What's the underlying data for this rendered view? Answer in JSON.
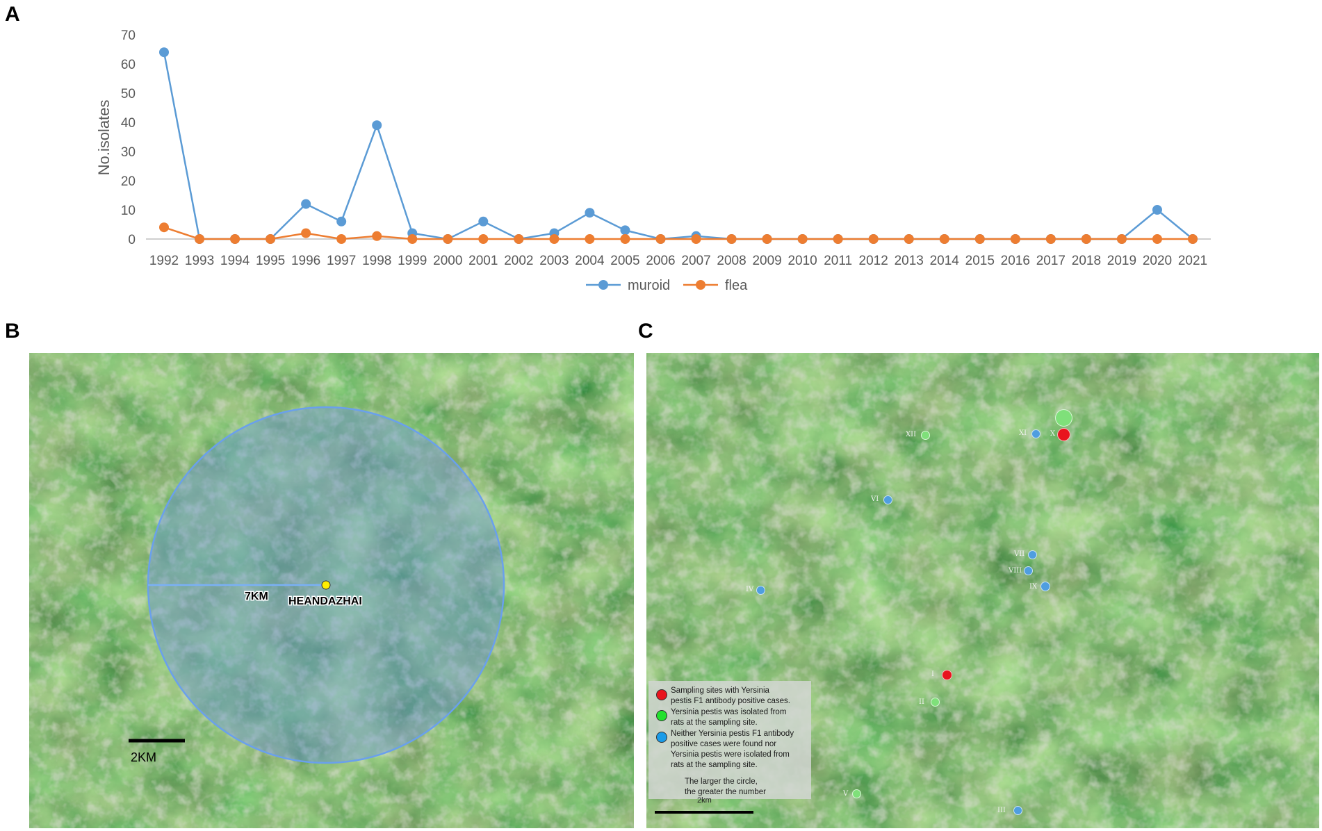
{
  "panels": {
    "a": "A",
    "b": "B",
    "c": "C"
  },
  "chart_data": {
    "type": "line",
    "ylabel": "No.isolates",
    "xlabel": "",
    "ylim": [
      0,
      70
    ],
    "yticks": [
      0,
      10,
      20,
      30,
      40,
      50,
      60,
      70
    ],
    "grid": false,
    "legend_position": "bottom",
    "categories": [
      "1992",
      "1993",
      "1994",
      "1995",
      "1996",
      "1997",
      "1998",
      "1999",
      "2000",
      "2001",
      "2002",
      "2003",
      "2004",
      "2005",
      "2006",
      "2007",
      "2008",
      "2009",
      "2010",
      "2011",
      "2012",
      "2013",
      "2014",
      "2015",
      "2016",
      "2017",
      "2018",
      "2019",
      "2020",
      "2021"
    ],
    "series": [
      {
        "name": "muroid",
        "color": "#5b9bd5",
        "values": [
          64,
          0,
          0,
          0,
          12,
          6,
          39,
          2,
          0,
          6,
          0,
          2,
          9,
          3,
          0,
          1,
          0,
          0,
          0,
          0,
          0,
          0,
          0,
          0,
          0,
          0,
          0,
          0,
          10,
          0
        ]
      },
      {
        "name": "flea",
        "color": "#ed7d31",
        "values": [
          4,
          0,
          0,
          0,
          2,
          0,
          1,
          0,
          0,
          0,
          0,
          0,
          0,
          0,
          0,
          0,
          0,
          0,
          0,
          0,
          0,
          0,
          0,
          0,
          0,
          0,
          0,
          0,
          0,
          0
        ]
      }
    ]
  },
  "map_b": {
    "radius_label": "7KM",
    "place_label": "HEANDAZHAI",
    "scale_label": "2KM",
    "circle_color": "#5b8fd6",
    "marker_color": "#ffee00"
  },
  "map_c": {
    "scale_label": "2km",
    "legend": {
      "items": [
        {
          "color": "#e8141e",
          "text": [
            "Sampling sites with Yersinia",
            "pestis F1 antibody positive cases."
          ]
        },
        {
          "color": "#22e02e",
          "text": [
            "Yersinia pestis was isolated from",
            "rats at the sampling site."
          ]
        },
        {
          "color": "#1a9be8",
          "text": [
            "Neither Yersinia pestis F1 antibody",
            "positive cases were found nor",
            "Yersinia pestis were isolated from",
            "rats at the sampling site."
          ]
        }
      ],
      "note": [
        "The larger the circle,",
        "the greater the number"
      ]
    },
    "sites": [
      {
        "label": "I",
        "color": "#e8141e",
        "size": 15
      },
      {
        "label": "II",
        "color": "#7fe07a",
        "size": 13
      },
      {
        "label": "III",
        "color": "#4f9ee0",
        "size": 13
      },
      {
        "label": "IV",
        "color": "#4f9ee0",
        "size": 13
      },
      {
        "label": "V",
        "color": "#7fe07a",
        "size": 13
      },
      {
        "label": "VI",
        "color": "#4f9ee0",
        "size": 13
      },
      {
        "label": "VII",
        "color": "#4f9ee0",
        "size": 13
      },
      {
        "label": "VIII",
        "color": "#4f9ee0",
        "size": 13
      },
      {
        "label": "IX",
        "color": "#4f9ee0",
        "size": 14
      },
      {
        "label": "X",
        "color": "#e8141e",
        "size": 19
      },
      {
        "label": "X",
        "color": "#7fe07a",
        "size": 25
      },
      {
        "label": "XI",
        "color": "#4f9ee0",
        "size": 13
      },
      {
        "label": "XII",
        "color": "#7fe07a",
        "size": 13
      }
    ]
  }
}
